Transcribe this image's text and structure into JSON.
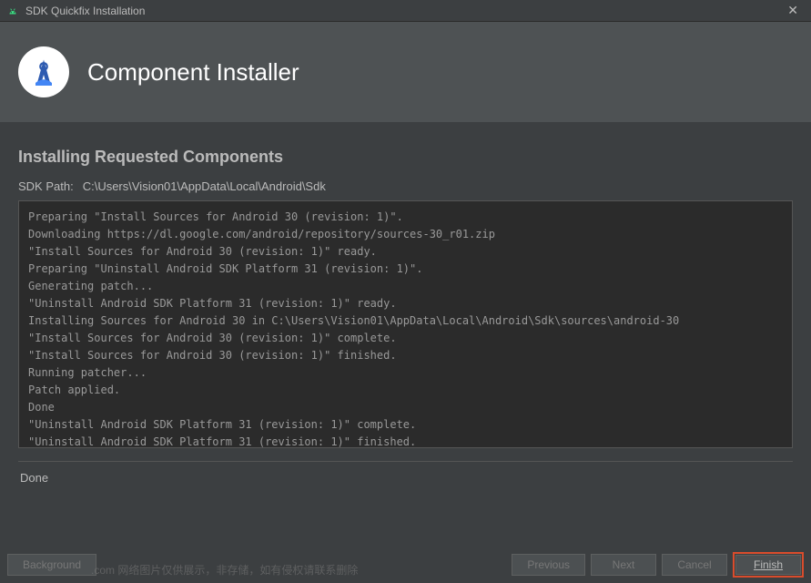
{
  "window": {
    "title": "SDK Quickfix Installation"
  },
  "header": {
    "title": "Component Installer"
  },
  "section": {
    "title": "Installing Requested Components"
  },
  "sdk_path": {
    "label": "SDK Path:",
    "value": "C:\\Users\\Vision01\\AppData\\Local\\Android\\Sdk"
  },
  "log": {
    "lines": [
      "Preparing \"Install Sources for Android 30 (revision: 1)\".",
      "Downloading https://dl.google.com/android/repository/sources-30_r01.zip",
      "\"Install Sources for Android 30 (revision: 1)\" ready.",
      "Preparing \"Uninstall Android SDK Platform 31 (revision: 1)\".",
      "Generating patch...",
      "\"Uninstall Android SDK Platform 31 (revision: 1)\" ready.",
      "Installing Sources for Android 30 in C:\\Users\\Vision01\\AppData\\Local\\Android\\Sdk\\sources\\android-30",
      "\"Install Sources for Android 30 (revision: 1)\" complete.",
      "\"Install Sources for Android 30 (revision: 1)\" finished.",
      "Running patcher...",
      "Patch applied.",
      "Done",
      "\"Uninstall Android SDK Platform 31 (revision: 1)\" complete.",
      "\"Uninstall Android SDK Platform 31 (revision: 1)\" finished."
    ]
  },
  "status": {
    "text": "Done"
  },
  "buttons": {
    "background": "Background",
    "previous": "Previous",
    "next": "Next",
    "cancel": "Cancel",
    "finish": "Finish"
  },
  "watermark": {
    "text": ".com 网络图片仅供展示，非存储，如有侵权请联系删除"
  }
}
